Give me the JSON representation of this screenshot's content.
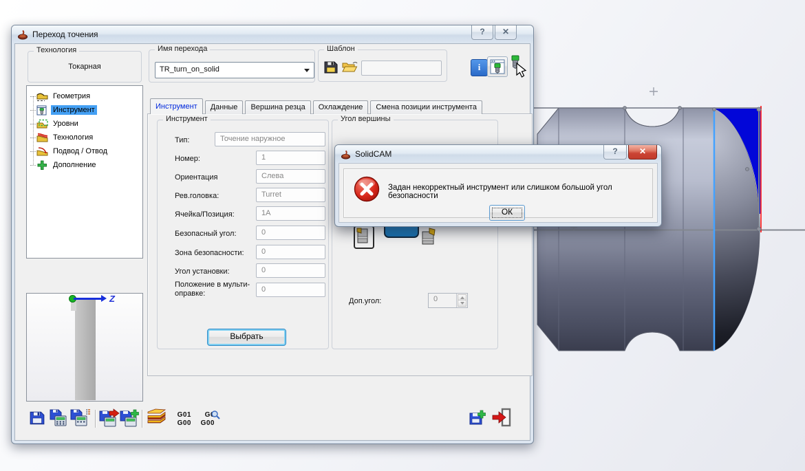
{
  "window": {
    "title": "Переход точения",
    "help_glyph": "?",
    "close_glyph": "✕"
  },
  "header": {
    "technology_group_label": "Технология",
    "technology_value": "Токарная",
    "operation_name_label": "Имя перехода",
    "operation_name_value": "TR_turn_on_solid",
    "template_group_label": "Шаблон",
    "template_value": "",
    "info_glyph": "i"
  },
  "tree": {
    "items": [
      {
        "label": "Геометрия"
      },
      {
        "label": "Инструмент"
      },
      {
        "label": "Уровни"
      },
      {
        "label": "Технология"
      },
      {
        "label": "Подвод / Отвод"
      },
      {
        "label": "Дополнение"
      }
    ]
  },
  "tabs": [
    {
      "label": "Инструмент"
    },
    {
      "label": "Данные"
    },
    {
      "label": "Вершина резца"
    },
    {
      "label": "Охлаждение"
    },
    {
      "label": "Смена позиции инструмента"
    }
  ],
  "tool_group": {
    "title": "Инструмент",
    "fields": [
      {
        "label": "Тип:",
        "value": "Точение наружное"
      },
      {
        "label": "Номер:",
        "value": "1"
      },
      {
        "label": "Ориентация",
        "value": "Слева"
      },
      {
        "label": "Рев.головка:",
        "value": "Turret"
      },
      {
        "label": "Ячейка/Позиция:",
        "value": "1A"
      },
      {
        "label": "Безопасный угол:",
        "value": "0"
      },
      {
        "label": "Зона безопасности:",
        "value": "0"
      },
      {
        "label": "Угол установки:",
        "value": "0"
      },
      {
        "label": "Положение в мульти-оправке:",
        "value": "0"
      }
    ],
    "select_button": "Выбрать"
  },
  "vertex_group": {
    "title": "Угол вершины",
    "extra_angle_label": "Доп.угол:",
    "extra_angle_value": "0"
  },
  "error_dialog": {
    "title": "SolidCAM",
    "help_glyph": "?",
    "close_glyph": "✕",
    "message": "Задан некорректный инструмент или слишком большой угол безопасности",
    "ok_label": "ОК"
  },
  "toolbar": {
    "g1_top": "G01",
    "g1_bottom": "G00",
    "g2_top": "G0",
    "g2_bottom": "G00"
  },
  "preview": {
    "axis_label": "Z"
  },
  "colors": {
    "selection_blue": "#44a0f4",
    "active_tab_text": "#0028dc",
    "error_red": "#cc1f14",
    "remaining_material_blue": "#0206d8",
    "cut_boundary_cyan": "#44a2ff",
    "stock_limit_red": "#ff0000"
  }
}
